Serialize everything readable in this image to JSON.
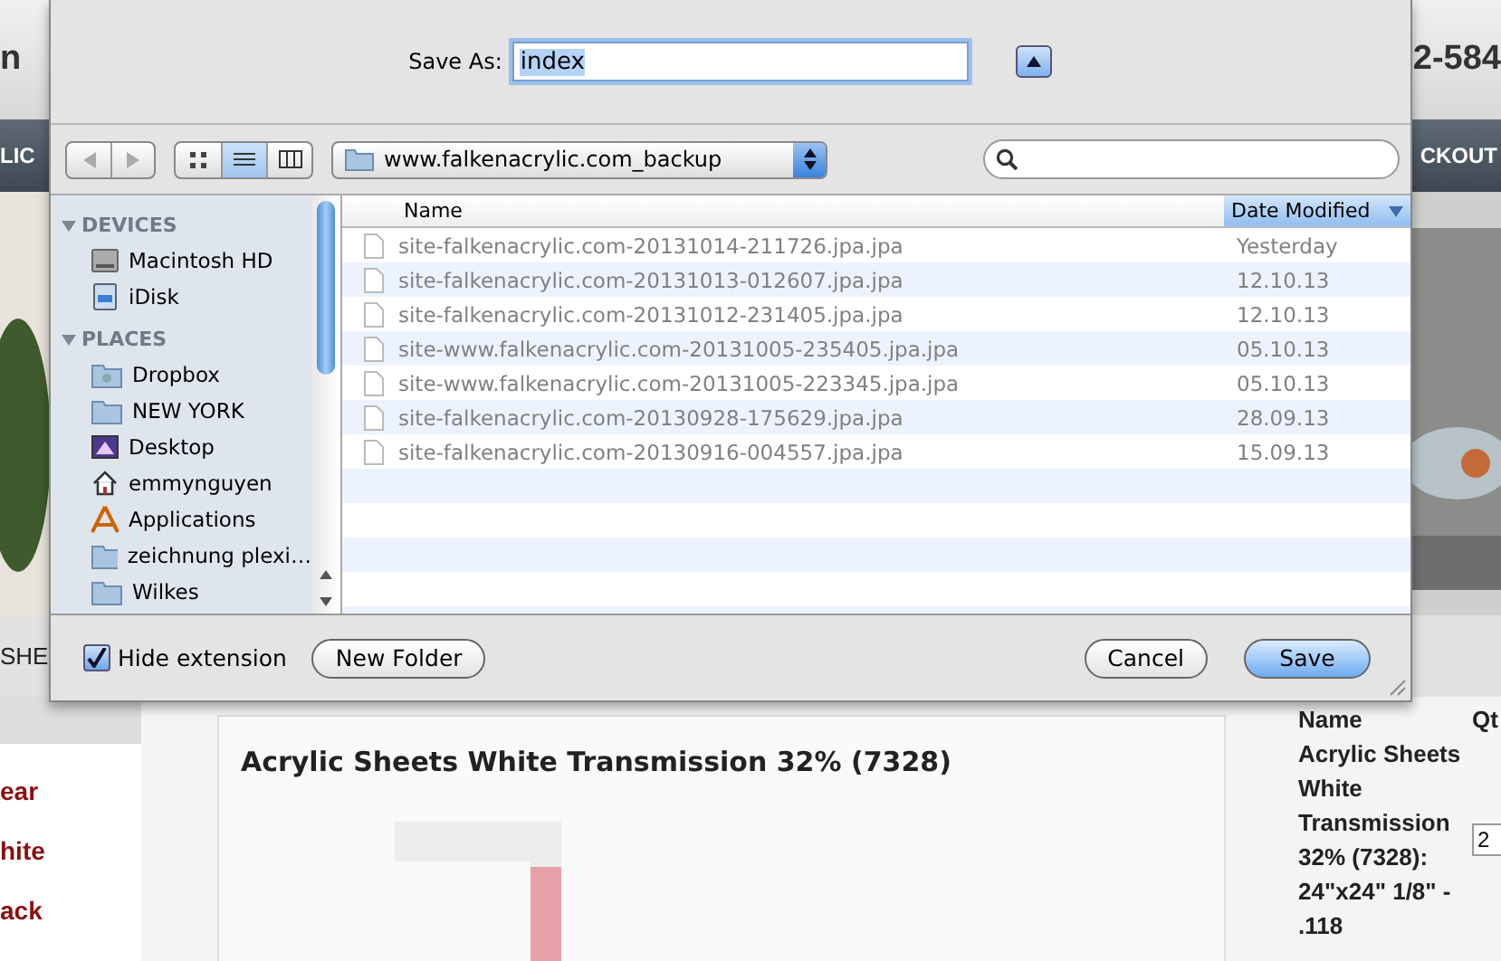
{
  "page": {
    "header_left": "n",
    "header_right": "2-584",
    "nav_left": "LIC",
    "nav_right": "CKOUT",
    "crumb_left": "SHE",
    "side_links": [
      "ear",
      "hite",
      "ack"
    ],
    "product_title": "Acrylic Sheets White Transmission 32% (7328)",
    "cart": {
      "name_header": "Name",
      "qty_header": "Qt",
      "item": "Acrylic Sheets White Transmission 32% (7328): 24\"x24\" 1/8\" - .118",
      "qty": "2"
    }
  },
  "dialog": {
    "save_as_label": "Save As:",
    "save_as_value": "index",
    "expanded": true,
    "toolbar": {
      "back_disabled": true,
      "forward_disabled": true,
      "views": [
        {
          "kind": "icons",
          "selected": false
        },
        {
          "kind": "list",
          "selected": true
        },
        {
          "kind": "columns",
          "selected": false
        }
      ],
      "location": "www.falkenacrylic.com_backup"
    },
    "sidebar": [
      {
        "title": "DEVICES",
        "expanded": true,
        "items": [
          {
            "label": "Macintosh HD",
            "kind": "drive"
          },
          {
            "label": "iDisk",
            "kind": "idisk"
          }
        ]
      },
      {
        "title": "PLACES",
        "expanded": true,
        "items": [
          {
            "label": "Dropbox",
            "kind": "dropbox"
          },
          {
            "label": "NEW YORK",
            "kind": "folder"
          },
          {
            "label": "Desktop",
            "kind": "desktop"
          },
          {
            "label": "emmynguyen",
            "kind": "home"
          },
          {
            "label": "Applications",
            "kind": "apps"
          },
          {
            "label": "zeichnung plexi…",
            "kind": "folder"
          },
          {
            "label": "Wilkes",
            "kind": "folder"
          }
        ]
      }
    ],
    "columns": [
      {
        "label": "Name",
        "selected": false
      },
      {
        "label": "Date Modified",
        "selected": true
      }
    ],
    "files": [
      {
        "name": "site-falkenacrylic.com-20131014-211726.jpa.jpa",
        "date": "Yesterday"
      },
      {
        "name": "site-falkenacrylic.com-20131013-012607.jpa.jpa",
        "date": "12.10.13"
      },
      {
        "name": "site-falkenacrylic.com-20131012-231405.jpa.jpa",
        "date": "12.10.13"
      },
      {
        "name": "site-www.falkenacrylic.com-20131005-235405.jpa.jpa",
        "date": "05.10.13"
      },
      {
        "name": "site-www.falkenacrylic.com-20131005-223345.jpa.jpa",
        "date": "05.10.13"
      },
      {
        "name": "site-falkenacrylic.com-20130928-175629.jpa.jpa",
        "date": "28.09.13"
      },
      {
        "name": "site-falkenacrylic.com-20130916-004557.jpa.jpa",
        "date": "15.09.13"
      }
    ],
    "hide_extension": {
      "label": "Hide extension",
      "checked": true
    },
    "buttons": [
      {
        "label": "New Folder",
        "kind": "plain"
      },
      {
        "label": "Cancel",
        "kind": "plain"
      },
      {
        "label": "Save",
        "kind": "default"
      }
    ]
  }
}
